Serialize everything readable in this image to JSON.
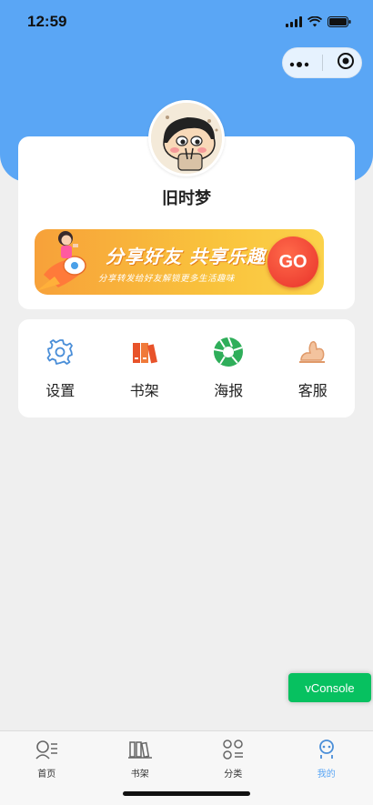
{
  "status_bar": {
    "time": "12:59"
  },
  "profile": {
    "username": "旧时梦"
  },
  "banner": {
    "title": "分享好友  共享乐趣",
    "subtitle": "分享转发给好友解锁更多生活趣味",
    "button_label": "GO"
  },
  "menu": [
    {
      "label": "设置",
      "icon": "gear-icon"
    },
    {
      "label": "书架",
      "icon": "bookshelf-icon"
    },
    {
      "label": "海报",
      "icon": "shutter-icon"
    },
    {
      "label": "客服",
      "icon": "customer-service-icon"
    }
  ],
  "vconsole": {
    "label": "vConsole"
  },
  "tabbar": {
    "items": [
      {
        "label": "首页",
        "icon": "home-icon"
      },
      {
        "label": "书架",
        "icon": "books-icon"
      },
      {
        "label": "分类",
        "icon": "category-icon"
      },
      {
        "label": "我的",
        "icon": "profile-icon",
        "active": true
      }
    ]
  },
  "colors": {
    "header_blue": "#5aa6f5",
    "accent_blue": "#5aa6f5",
    "vconsole_green": "#07c160",
    "go_red": "#e8322a",
    "banner_orange": "#f7a13a"
  }
}
